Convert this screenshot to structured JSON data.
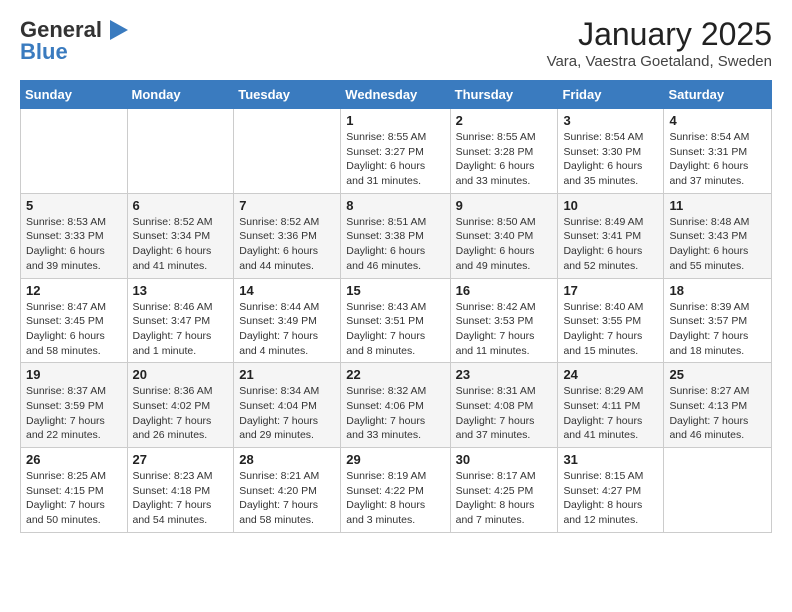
{
  "header": {
    "logo_general": "General",
    "logo_blue": "Blue",
    "title": "January 2025",
    "subtitle": "Vara, Vaestra Goetaland, Sweden"
  },
  "weekdays": [
    "Sunday",
    "Monday",
    "Tuesday",
    "Wednesday",
    "Thursday",
    "Friday",
    "Saturday"
  ],
  "weeks": [
    [
      {
        "day": "",
        "info": ""
      },
      {
        "day": "",
        "info": ""
      },
      {
        "day": "",
        "info": ""
      },
      {
        "day": "1",
        "info": "Sunrise: 8:55 AM\nSunset: 3:27 PM\nDaylight: 6 hours and 31 minutes."
      },
      {
        "day": "2",
        "info": "Sunrise: 8:55 AM\nSunset: 3:28 PM\nDaylight: 6 hours and 33 minutes."
      },
      {
        "day": "3",
        "info": "Sunrise: 8:54 AM\nSunset: 3:30 PM\nDaylight: 6 hours and 35 minutes."
      },
      {
        "day": "4",
        "info": "Sunrise: 8:54 AM\nSunset: 3:31 PM\nDaylight: 6 hours and 37 minutes."
      }
    ],
    [
      {
        "day": "5",
        "info": "Sunrise: 8:53 AM\nSunset: 3:33 PM\nDaylight: 6 hours and 39 minutes."
      },
      {
        "day": "6",
        "info": "Sunrise: 8:52 AM\nSunset: 3:34 PM\nDaylight: 6 hours and 41 minutes."
      },
      {
        "day": "7",
        "info": "Sunrise: 8:52 AM\nSunset: 3:36 PM\nDaylight: 6 hours and 44 minutes."
      },
      {
        "day": "8",
        "info": "Sunrise: 8:51 AM\nSunset: 3:38 PM\nDaylight: 6 hours and 46 minutes."
      },
      {
        "day": "9",
        "info": "Sunrise: 8:50 AM\nSunset: 3:40 PM\nDaylight: 6 hours and 49 minutes."
      },
      {
        "day": "10",
        "info": "Sunrise: 8:49 AM\nSunset: 3:41 PM\nDaylight: 6 hours and 52 minutes."
      },
      {
        "day": "11",
        "info": "Sunrise: 8:48 AM\nSunset: 3:43 PM\nDaylight: 6 hours and 55 minutes."
      }
    ],
    [
      {
        "day": "12",
        "info": "Sunrise: 8:47 AM\nSunset: 3:45 PM\nDaylight: 6 hours and 58 minutes."
      },
      {
        "day": "13",
        "info": "Sunrise: 8:46 AM\nSunset: 3:47 PM\nDaylight: 7 hours and 1 minute."
      },
      {
        "day": "14",
        "info": "Sunrise: 8:44 AM\nSunset: 3:49 PM\nDaylight: 7 hours and 4 minutes."
      },
      {
        "day": "15",
        "info": "Sunrise: 8:43 AM\nSunset: 3:51 PM\nDaylight: 7 hours and 8 minutes."
      },
      {
        "day": "16",
        "info": "Sunrise: 8:42 AM\nSunset: 3:53 PM\nDaylight: 7 hours and 11 minutes."
      },
      {
        "day": "17",
        "info": "Sunrise: 8:40 AM\nSunset: 3:55 PM\nDaylight: 7 hours and 15 minutes."
      },
      {
        "day": "18",
        "info": "Sunrise: 8:39 AM\nSunset: 3:57 PM\nDaylight: 7 hours and 18 minutes."
      }
    ],
    [
      {
        "day": "19",
        "info": "Sunrise: 8:37 AM\nSunset: 3:59 PM\nDaylight: 7 hours and 22 minutes."
      },
      {
        "day": "20",
        "info": "Sunrise: 8:36 AM\nSunset: 4:02 PM\nDaylight: 7 hours and 26 minutes."
      },
      {
        "day": "21",
        "info": "Sunrise: 8:34 AM\nSunset: 4:04 PM\nDaylight: 7 hours and 29 minutes."
      },
      {
        "day": "22",
        "info": "Sunrise: 8:32 AM\nSunset: 4:06 PM\nDaylight: 7 hours and 33 minutes."
      },
      {
        "day": "23",
        "info": "Sunrise: 8:31 AM\nSunset: 4:08 PM\nDaylight: 7 hours and 37 minutes."
      },
      {
        "day": "24",
        "info": "Sunrise: 8:29 AM\nSunset: 4:11 PM\nDaylight: 7 hours and 41 minutes."
      },
      {
        "day": "25",
        "info": "Sunrise: 8:27 AM\nSunset: 4:13 PM\nDaylight: 7 hours and 46 minutes."
      }
    ],
    [
      {
        "day": "26",
        "info": "Sunrise: 8:25 AM\nSunset: 4:15 PM\nDaylight: 7 hours and 50 minutes."
      },
      {
        "day": "27",
        "info": "Sunrise: 8:23 AM\nSunset: 4:18 PM\nDaylight: 7 hours and 54 minutes."
      },
      {
        "day": "28",
        "info": "Sunrise: 8:21 AM\nSunset: 4:20 PM\nDaylight: 7 hours and 58 minutes."
      },
      {
        "day": "29",
        "info": "Sunrise: 8:19 AM\nSunset: 4:22 PM\nDaylight: 8 hours and 3 minutes."
      },
      {
        "day": "30",
        "info": "Sunrise: 8:17 AM\nSunset: 4:25 PM\nDaylight: 8 hours and 7 minutes."
      },
      {
        "day": "31",
        "info": "Sunrise: 8:15 AM\nSunset: 4:27 PM\nDaylight: 8 hours and 12 minutes."
      },
      {
        "day": "",
        "info": ""
      }
    ]
  ]
}
